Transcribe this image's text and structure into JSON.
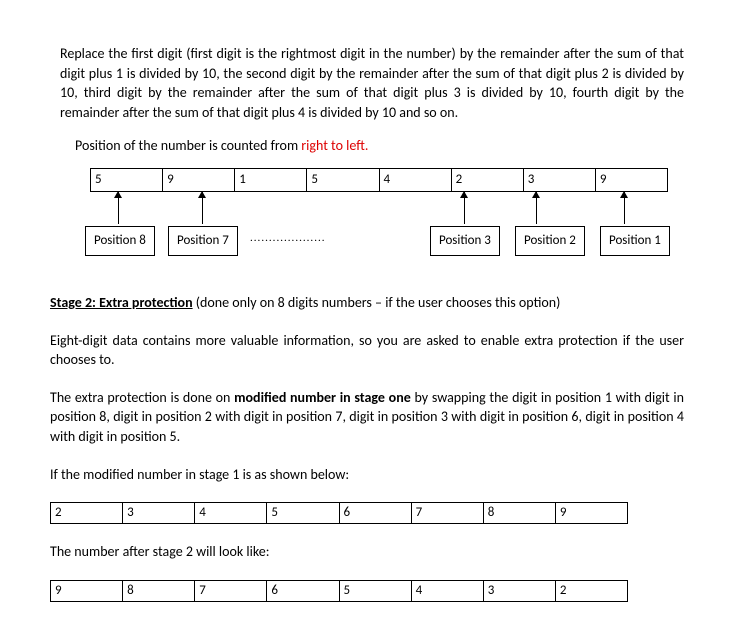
{
  "para1": "Replace the first digit (first digit is the rightmost digit in the number) by the remainder after the sum of that digit plus 1 is divided by 10, the second digit by the remainder after the sum of that digit plus 2 is divided by 10, third digit by the remainder after the sum of that digit plus 3 is divided by 10, fourth digit by the remainder after the sum of that digit plus 4 is divided by 10 and so on.",
  "pos_line_prefix": "Position of the number is counted from ",
  "pos_line_red": "right to left.",
  "diagram": {
    "digits": [
      "5",
      "9",
      "1",
      "5",
      "4",
      "2",
      "3",
      "9"
    ],
    "positions": {
      "p8": "Position 8",
      "p7": "Position 7",
      "p3": "Position 3",
      "p2": "Position 2",
      "p1": "Position 1"
    },
    "dots": "...................."
  },
  "stage2_heading": "Stage 2: Extra protection",
  "stage2_suffix": " (done only on 8 digits numbers – if the user chooses this option)",
  "para2": "Eight-digit data contains more valuable information, so you are asked to enable extra protection if the user chooses to.",
  "para3_a": "The extra protection is done on ",
  "para3_bold": "modified number in stage one",
  "para3_b": " by swapping the digit in position 1 with digit in position 8, digit in position 2 with digit in position 7, digit in position 3 with digit in position 6, digit in position 4 with digit in position 5.",
  "para4": "If the modified number in stage 1 is as shown below:",
  "row1": [
    "2",
    "3",
    "4",
    "5",
    "6",
    "7",
    "8",
    "9"
  ],
  "para5": "The number after stage 2 will look like:",
  "row2": [
    "9",
    "8",
    "7",
    "6",
    "5",
    "4",
    "3",
    "2"
  ]
}
